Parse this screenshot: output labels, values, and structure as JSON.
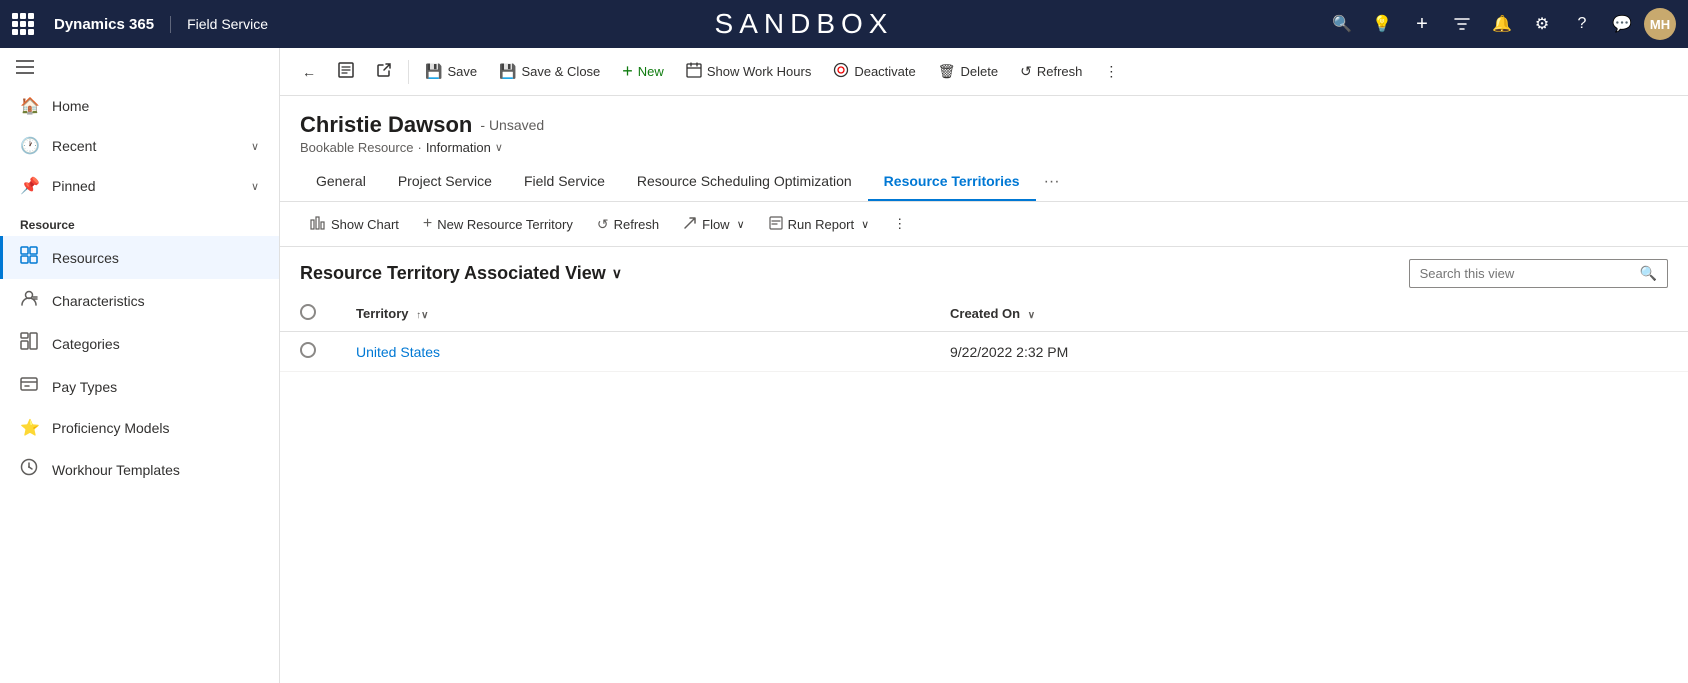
{
  "topNav": {
    "brand": "Dynamics 365",
    "appName": "Field Service",
    "sandboxTitle": "SANDBOX",
    "userInitials": "MH",
    "icons": {
      "search": "🔍",
      "lightbulb": "💡",
      "plus": "+",
      "filter": "⊤",
      "bell": "🔔",
      "settings": "⚙",
      "help": "?",
      "chat": "💬"
    }
  },
  "sidebar": {
    "navItems": [
      {
        "id": "home",
        "label": "Home",
        "icon": "🏠"
      },
      {
        "id": "recent",
        "label": "Recent",
        "icon": "🕐",
        "hasChevron": true
      },
      {
        "id": "pinned",
        "label": "Pinned",
        "icon": "📌",
        "hasChevron": true
      }
    ],
    "sectionLabel": "Resource",
    "resourceItems": [
      {
        "id": "resources",
        "label": "Resources",
        "icon": "👤",
        "active": true
      },
      {
        "id": "characteristics",
        "label": "Characteristics",
        "icon": "👥"
      },
      {
        "id": "categories",
        "label": "Categories",
        "icon": "📊"
      },
      {
        "id": "pay-types",
        "label": "Pay Types",
        "icon": "📋"
      },
      {
        "id": "proficiency-models",
        "label": "Proficiency Models",
        "icon": "⭐"
      },
      {
        "id": "workhour-templates",
        "label": "Workhour Templates",
        "icon": "⏱"
      }
    ]
  },
  "toolbar": {
    "buttons": [
      {
        "id": "back",
        "label": "",
        "icon": "←"
      },
      {
        "id": "form-view",
        "label": "",
        "icon": "📄"
      },
      {
        "id": "open-in-new",
        "label": "",
        "icon": "↗"
      },
      {
        "id": "save",
        "label": "Save",
        "icon": "💾"
      },
      {
        "id": "save-close",
        "label": "Save & Close",
        "icon": "💾"
      },
      {
        "id": "new",
        "label": "New",
        "icon": "+"
      },
      {
        "id": "show-work-hours",
        "label": "Show Work Hours",
        "icon": "📅"
      },
      {
        "id": "deactivate",
        "label": "Deactivate",
        "icon": "🚫"
      },
      {
        "id": "delete",
        "label": "Delete",
        "icon": "🗑"
      },
      {
        "id": "refresh",
        "label": "Refresh",
        "icon": "↺"
      },
      {
        "id": "more",
        "label": "",
        "icon": "⋮"
      }
    ]
  },
  "record": {
    "name": "Christie Dawson",
    "status": "Unsaved",
    "entityType": "Bookable Resource",
    "formName": "Information"
  },
  "tabs": [
    {
      "id": "general",
      "label": "General",
      "active": false
    },
    {
      "id": "project-service",
      "label": "Project Service",
      "active": false
    },
    {
      "id": "field-service",
      "label": "Field Service",
      "active": false
    },
    {
      "id": "rso",
      "label": "Resource Scheduling Optimization",
      "active": false
    },
    {
      "id": "resource-territories",
      "label": "Resource Territories",
      "active": true
    }
  ],
  "subgridToolbar": {
    "buttons": [
      {
        "id": "show-chart",
        "label": "Show Chart",
        "icon": "📈"
      },
      {
        "id": "new-resource-territory",
        "label": "New Resource Territory",
        "icon": "+"
      },
      {
        "id": "refresh",
        "label": "Refresh",
        "icon": "↺"
      },
      {
        "id": "flow",
        "label": "Flow",
        "icon": "⇗",
        "hasChevron": true
      },
      {
        "id": "run-report",
        "label": "Run Report",
        "icon": "📊",
        "hasChevron": true
      },
      {
        "id": "more",
        "label": "",
        "icon": "⋮"
      }
    ]
  },
  "subgrid": {
    "title": "Resource Territory Associated View",
    "searchPlaceholder": "Search this view",
    "columns": [
      {
        "id": "territory",
        "label": "Territory",
        "sortable": true
      },
      {
        "id": "created-on",
        "label": "Created On",
        "sortable": true
      }
    ],
    "rows": [
      {
        "territory": "United States",
        "createdOn": "9/22/2022 2:32 PM"
      }
    ]
  }
}
